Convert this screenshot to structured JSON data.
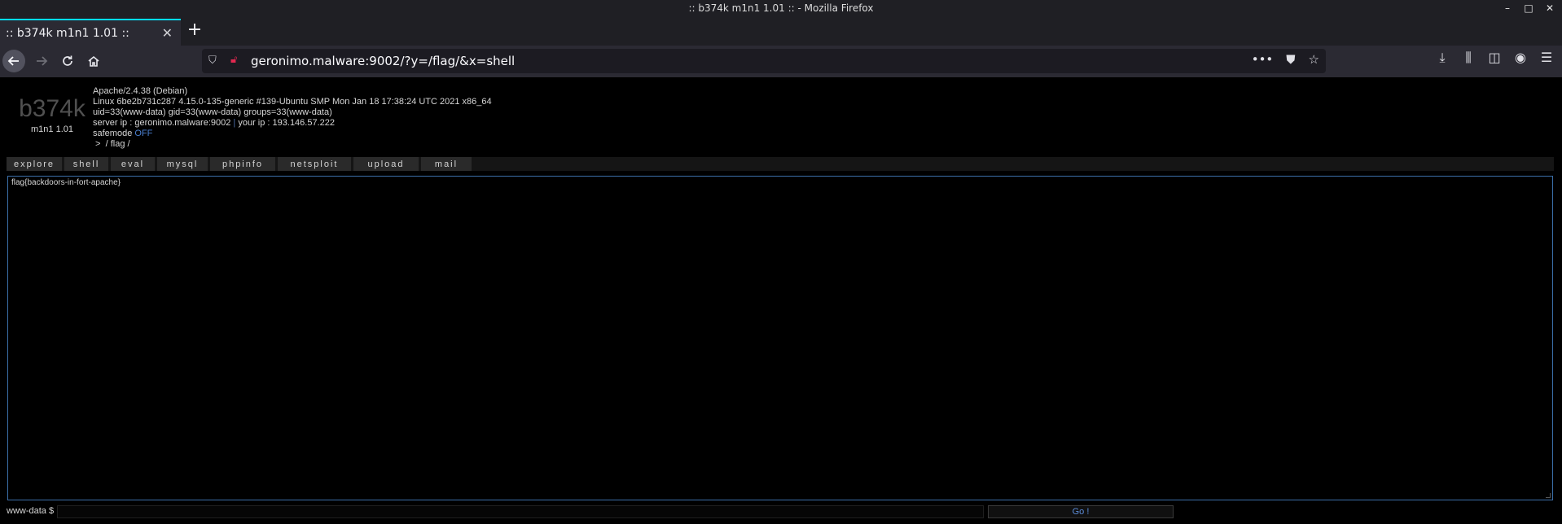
{
  "window": {
    "title": ":: b374k m1n1 1.01 :: - Mozilla Firefox",
    "controls": {
      "minimize": "–",
      "maximize": "□",
      "close": "✕"
    }
  },
  "tab": {
    "title": ":: b374k m1n1 1.01 ::",
    "close": "✕",
    "new_tab": "+"
  },
  "toolbar": {
    "url": "geronimo.malware:9002/?y=/flag/&x=shell",
    "icons": [
      "shield-icon",
      "insecure-lock-icon",
      "more-icon",
      "pocket-icon",
      "bookmark-star-icon",
      "download-icon",
      "library-icon",
      "sidebar-icon",
      "account-icon",
      "menu-icon"
    ]
  },
  "header": {
    "logo": "b374k",
    "version": "m1n1 1.01",
    "server_software": "Apache/2.4.38 (Debian)",
    "uname": "Linux 6be2b731c287 4.15.0-135-generic #139-Ubuntu SMP Mon Jan 18 17:38:24 UTC 2021 x86_64",
    "uid": "uid=33(www-data) gid=33(www-data) groups=33(www-data)",
    "server_ip": "server ip : geronimo.malware:9002",
    "separator": "|",
    "your_ip": "your ip : 193.146.57.222",
    "safemode_label": "safemode",
    "safemode_value": "OFF",
    "path": " >  / flag /"
  },
  "menu": [
    {
      "label": "explore"
    },
    {
      "label": "shell"
    },
    {
      "label": "eval"
    },
    {
      "label": "mysql"
    },
    {
      "label": "phpinfo"
    },
    {
      "label": "netsploit"
    },
    {
      "label": "upload"
    },
    {
      "label": "mail"
    }
  ],
  "output": {
    "text": "flag{backdoors-in-fort-apache}"
  },
  "command": {
    "prompt": "www-data $",
    "value": "",
    "go_label": "Go !"
  },
  "colors": {
    "accent": "#00ddff",
    "link_blue": "#4a7fd0",
    "border_blue": "#3b6fa8"
  }
}
